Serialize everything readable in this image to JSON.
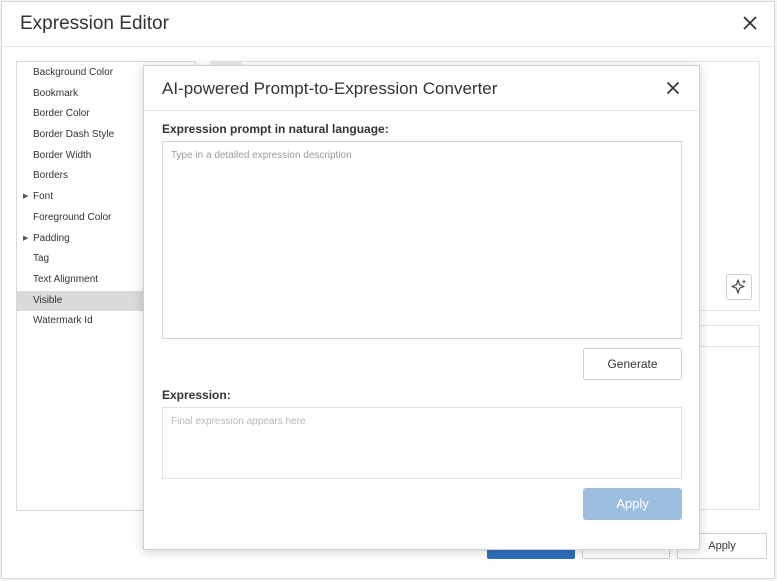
{
  "outer_dialog": {
    "title": "Expression Editor",
    "close_icon": "close-icon",
    "properties": [
      {
        "label": "Background Color",
        "expandable": false,
        "selected": false
      },
      {
        "label": "Bookmark",
        "expandable": false,
        "selected": false
      },
      {
        "label": "Border Color",
        "expandable": false,
        "selected": false
      },
      {
        "label": "Border Dash Style",
        "expandable": false,
        "selected": false
      },
      {
        "label": "Border Width",
        "expandable": false,
        "selected": false
      },
      {
        "label": "Borders",
        "expandable": false,
        "selected": false
      },
      {
        "label": "Font",
        "expandable": true,
        "selected": false
      },
      {
        "label": "Foreground Color",
        "expandable": false,
        "selected": false
      },
      {
        "label": "Padding",
        "expandable": true,
        "selected": false
      },
      {
        "label": "Tag",
        "expandable": false,
        "selected": false
      },
      {
        "label": "Text Alignment",
        "expandable": false,
        "selected": false
      },
      {
        "label": "Visible",
        "expandable": false,
        "selected": true
      },
      {
        "label": "Watermark Id",
        "expandable": false,
        "selected": false
      }
    ],
    "ai_button_icon": "sparkle-icon",
    "apply_label": "Apply"
  },
  "modal": {
    "title": "AI-powered Prompt-to-Expression Converter",
    "close_icon": "close-icon",
    "prompt_label": "Expression prompt in natural language:",
    "prompt_placeholder": "Type in a detailed expression description",
    "prompt_value": "",
    "generate_label": "Generate",
    "expression_label": "Expression:",
    "expression_placeholder": "Final expression appears here",
    "expression_value": "",
    "apply_label": "Apply"
  },
  "colors": {
    "primary": "#2f6fbf",
    "primary_disabled": "#9dbfdf",
    "selection": "#dadada",
    "border": "#d4d4d4"
  }
}
